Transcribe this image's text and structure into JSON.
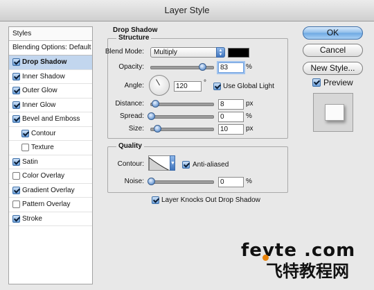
{
  "window": {
    "title": "Layer Style"
  },
  "styles_panel": {
    "header": "Styles",
    "blending_options": "Blending Options: Default",
    "items": [
      {
        "label": "Drop Shadow",
        "checked": true,
        "selected": true,
        "indent": 0
      },
      {
        "label": "Inner Shadow",
        "checked": true,
        "selected": false,
        "indent": 0
      },
      {
        "label": "Outer Glow",
        "checked": true,
        "selected": false,
        "indent": 0
      },
      {
        "label": "Inner Glow",
        "checked": true,
        "selected": false,
        "indent": 0
      },
      {
        "label": "Bevel and Emboss",
        "checked": true,
        "selected": false,
        "indent": 0
      },
      {
        "label": "Contour",
        "checked": true,
        "selected": false,
        "indent": 1
      },
      {
        "label": "Texture",
        "checked": false,
        "selected": false,
        "indent": 1
      },
      {
        "label": "Satin",
        "checked": true,
        "selected": false,
        "indent": 0
      },
      {
        "label": "Color Overlay",
        "checked": false,
        "selected": false,
        "indent": 0
      },
      {
        "label": "Gradient Overlay",
        "checked": true,
        "selected": false,
        "indent": 0
      },
      {
        "label": "Pattern Overlay",
        "checked": false,
        "selected": false,
        "indent": 0
      },
      {
        "label": "Stroke",
        "checked": true,
        "selected": false,
        "indent": 0
      }
    ]
  },
  "drop_shadow": {
    "section_title": "Drop Shadow",
    "structure": {
      "title": "Structure",
      "blend_mode_label": "Blend Mode:",
      "blend_mode_value": "Multiply",
      "shadow_color": "#000000",
      "opacity_label": "Opacity:",
      "opacity_value": "83",
      "opacity_unit": "%",
      "opacity_fraction": 0.83,
      "angle_label": "Angle:",
      "angle_value": "120",
      "angle_unit": "°",
      "use_global_light_label": "Use Global Light",
      "use_global_light_checked": true,
      "distance_label": "Distance:",
      "distance_value": "8",
      "distance_unit": "px",
      "spread_label": "Spread:",
      "spread_value": "0",
      "spread_unit": "%",
      "size_label": "Size:",
      "size_value": "10",
      "size_unit": "px"
    },
    "quality": {
      "title": "Quality",
      "contour_label": "Contour:",
      "anti_aliased_label": "Anti-aliased",
      "anti_aliased_checked": true,
      "noise_label": "Noise:",
      "noise_value": "0",
      "noise_unit": "%"
    },
    "knocks_out_label": "Layer Knocks Out Drop Shadow",
    "knocks_out_checked": true
  },
  "buttons": {
    "ok": "OK",
    "cancel": "Cancel",
    "new_style": "New Style...",
    "preview_label": "Preview",
    "preview_checked": true
  },
  "watermark": {
    "line1": "fevte .com",
    "line2": "飞特教程网"
  },
  "colors": {
    "accent": "#6da8e3",
    "selected_row": "#c2d6ee",
    "watermark_dot": "#e8830b"
  }
}
